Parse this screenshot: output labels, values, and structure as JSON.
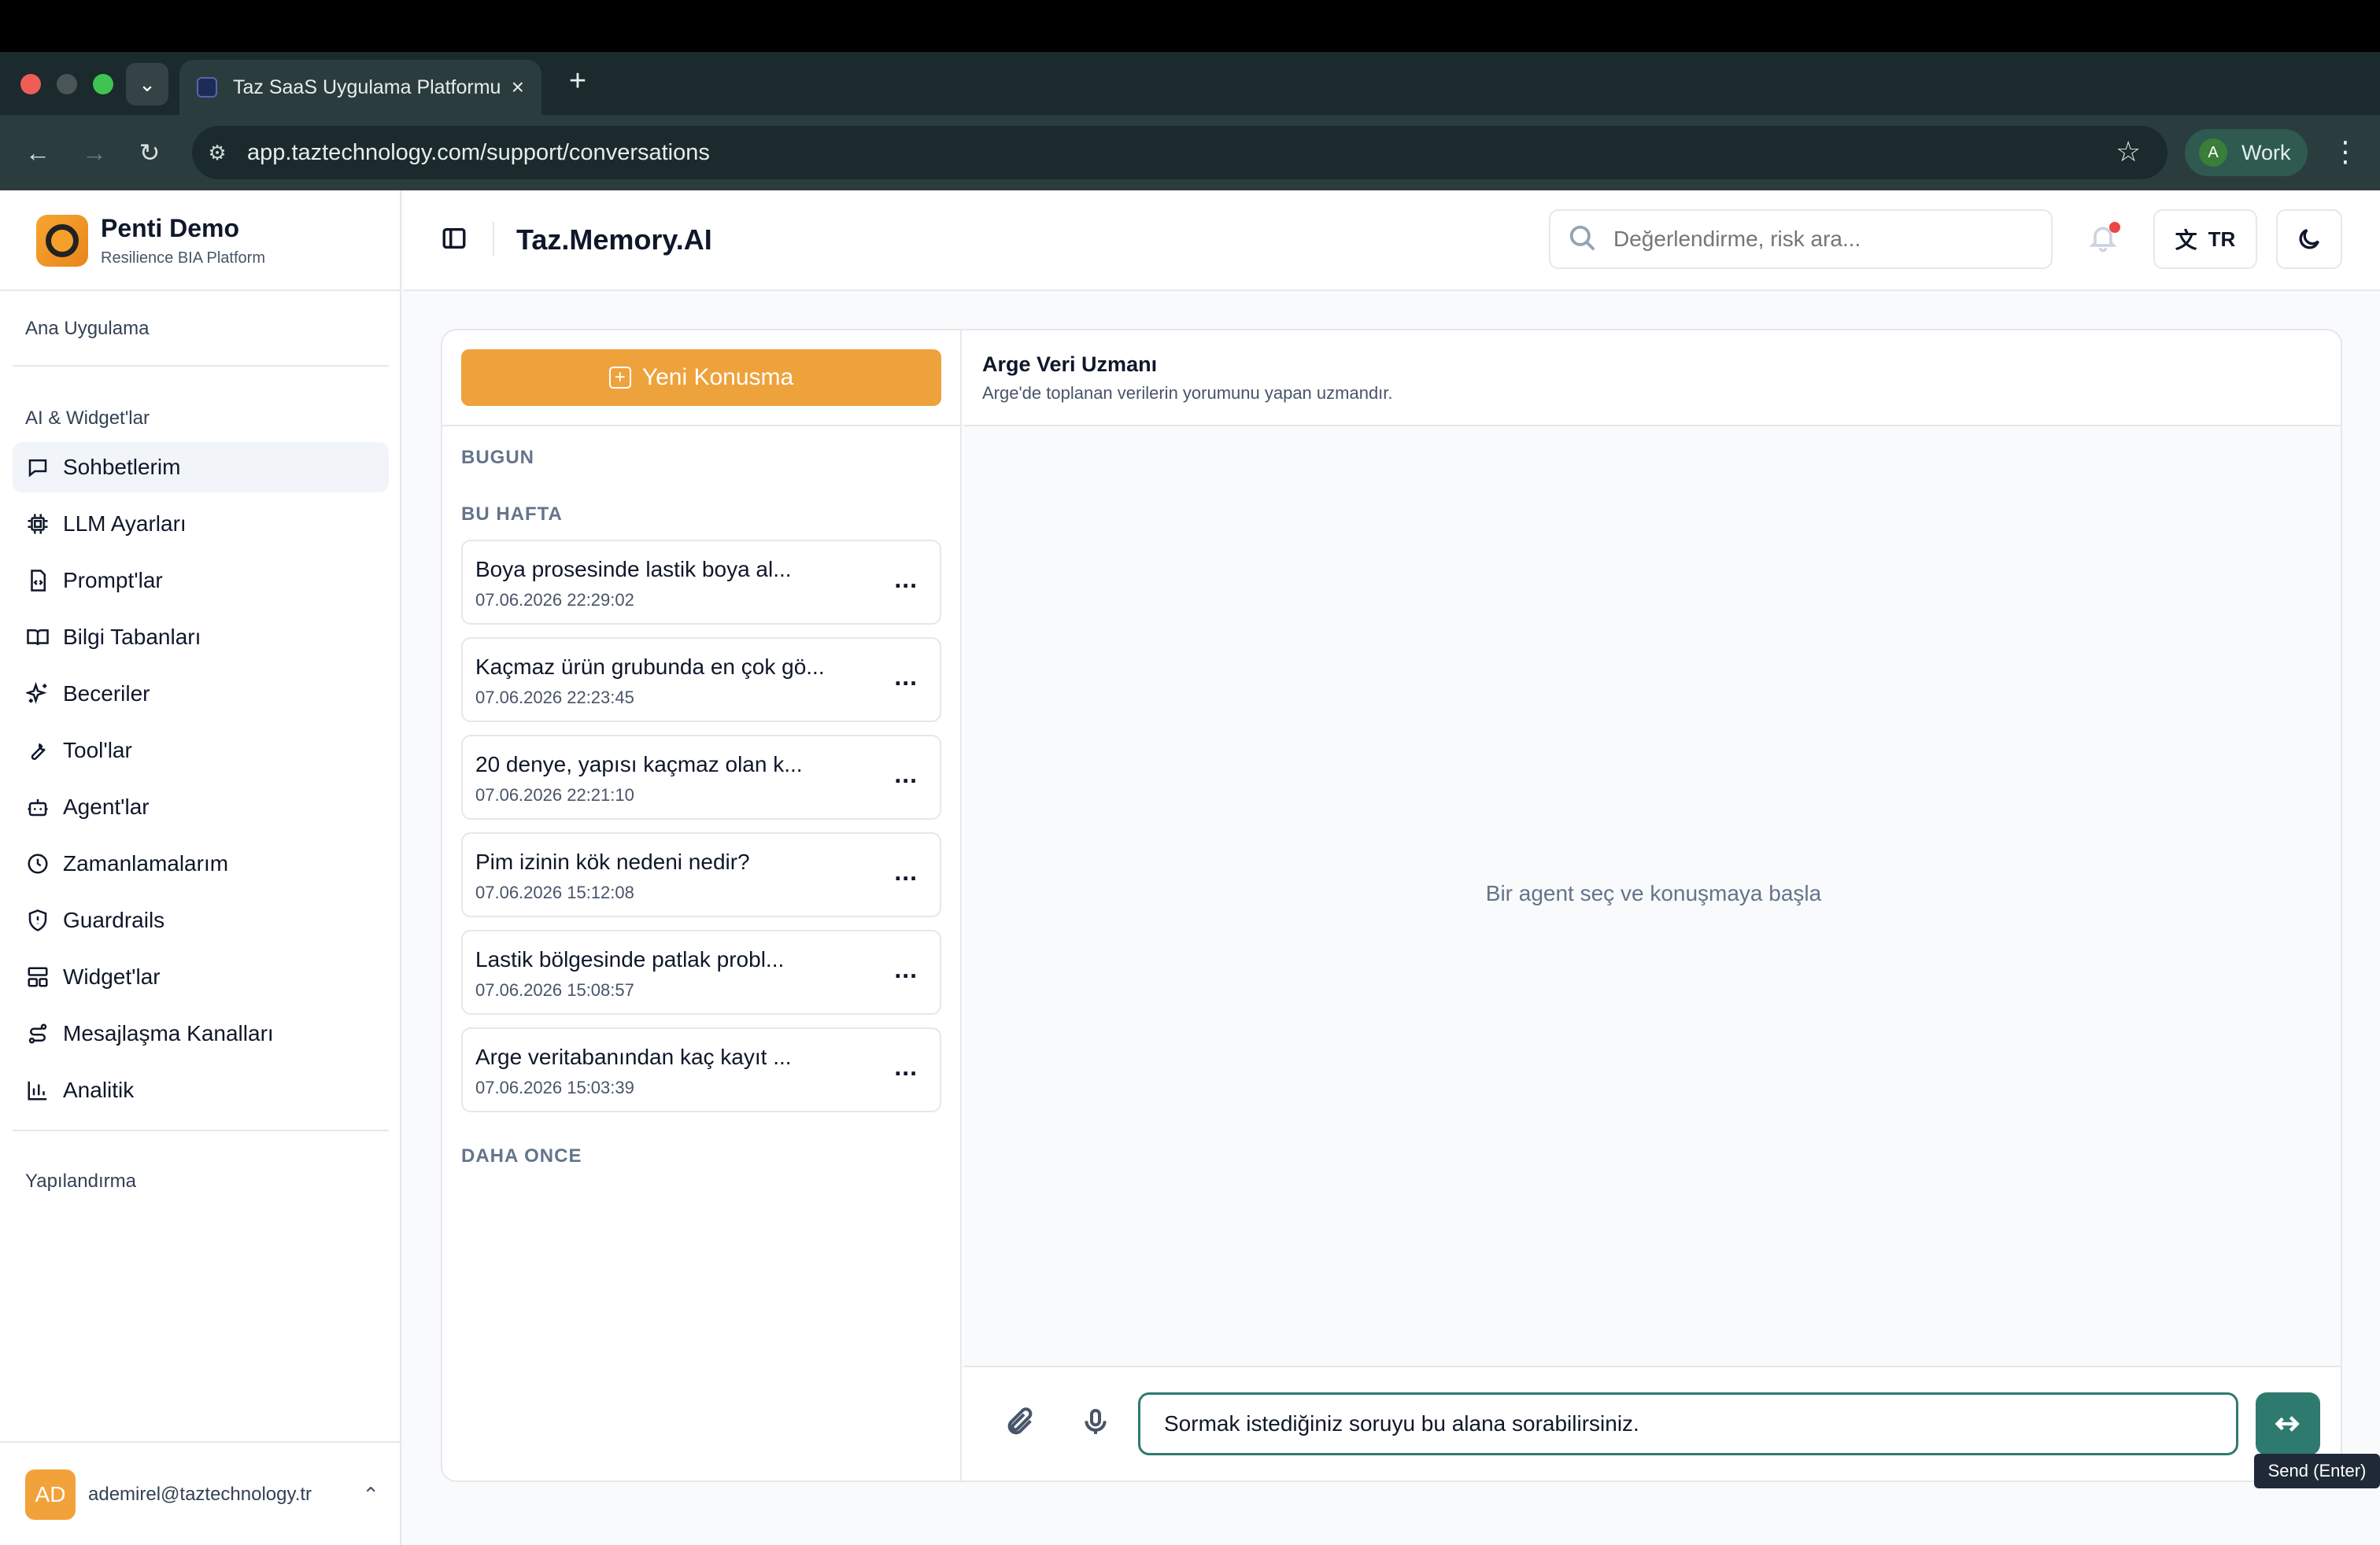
{
  "browser": {
    "tab_title": "Taz SaaS Uygulama Platformu",
    "url": "app.taztechnology.com/support/conversations",
    "profile_initial": "A",
    "profile_label": "Work"
  },
  "brand": {
    "name": "Penti Demo",
    "subtitle": "Resilience BIA Platform"
  },
  "sidebar": {
    "group_main": "Ana Uygulama",
    "group_ai": "AI & Widget'lar",
    "group_config": "Yapılandırma",
    "items": [
      {
        "label": "Sohbetlerim",
        "icon": "chat-icon",
        "active": true
      },
      {
        "label": "LLM Ayarları",
        "icon": "chip-icon"
      },
      {
        "label": "Prompt'lar",
        "icon": "file-code-icon"
      },
      {
        "label": "Bilgi Tabanları",
        "icon": "book-icon"
      },
      {
        "label": "Beceriler",
        "icon": "sparkles-icon"
      },
      {
        "label": "Tool'lar",
        "icon": "wrench-icon"
      },
      {
        "label": "Agent'lar",
        "icon": "bot-icon"
      },
      {
        "label": "Zamanlamalarım",
        "icon": "clock-icon"
      },
      {
        "label": "Guardrails",
        "icon": "shield-icon"
      },
      {
        "label": "Widget'lar",
        "icon": "layout-icon"
      },
      {
        "label": "Mesajlaşma Kanalları",
        "icon": "route-icon"
      },
      {
        "label": "Analitik",
        "icon": "bar-chart-icon"
      }
    ],
    "user": {
      "initials": "AD",
      "email": "ademirel@taztechnology.tr"
    }
  },
  "header": {
    "title": "Taz.Memory.AI",
    "search_placeholder": "Değerlendirme, risk ara...",
    "lang": "TR"
  },
  "conversations": {
    "new_button": "Yeni Konusma",
    "section_today": "BUGUN",
    "section_week": "BU HAFTA",
    "section_before": "DAHA ONCE",
    "items": [
      {
        "title": "Boya prosesinde lastik boya al...",
        "time": "07.06.2026 22:29:02"
      },
      {
        "title": "Kaçmaz ürün grubunda en çok gö...",
        "time": "07.06.2026 22:23:45"
      },
      {
        "title": "20 denye, yapısı kaçmaz olan k...",
        "time": "07.06.2026 22:21:10"
      },
      {
        "title": "Pim izinin kök nedeni nedir?",
        "time": "07.06.2026 15:12:08"
      },
      {
        "title": "Lastik bölgesinde patlak probl...",
        "time": "07.06.2026 15:08:57"
      },
      {
        "title": "Arge veritabanından kaç kayıt ...",
        "time": "07.06.2026 15:03:39"
      }
    ],
    "more_label": "..."
  },
  "chat": {
    "agent_name": "Arge Veri Uzmanı",
    "agent_desc": "Arge'de toplanan verilerin yorumunu yapan uzmandır.",
    "empty_message": "Bir agent seç ve konuşmaya başla",
    "input_placeholder": "Sormak istediğiniz soruyu bu alana sorabilirsiniz.",
    "send_tooltip": "Send (Enter)"
  },
  "colors": {
    "accent_orange": "#eea23c",
    "accent_teal": "#2f7a6e"
  }
}
